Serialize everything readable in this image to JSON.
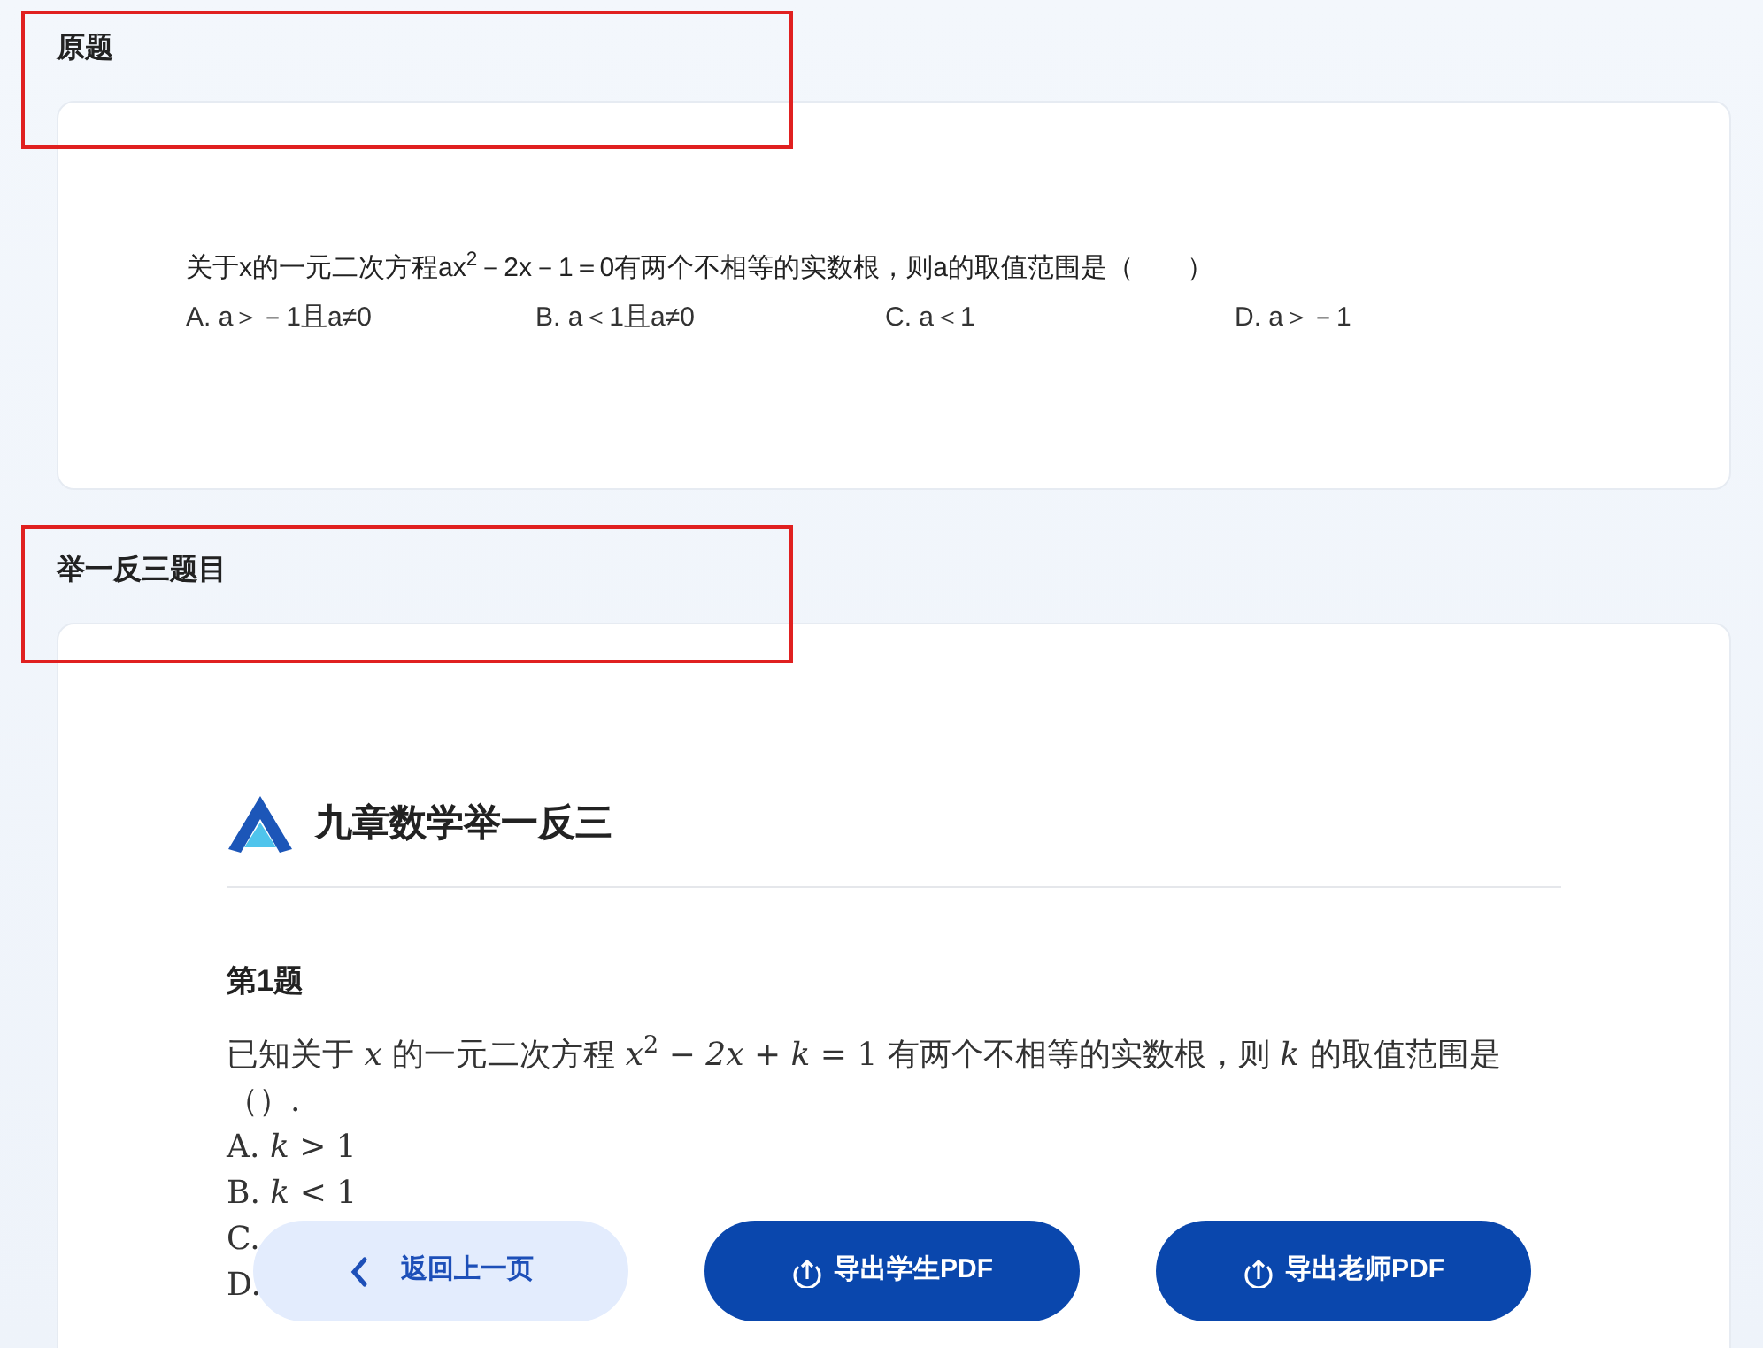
{
  "original": {
    "title": "原题",
    "question": "关于x的一元二次方程ax$^{2}$－2x－1＝0有两个不相等的实数根，则a的取值范围是（　　）",
    "options": [
      "A. a＞－1且a≠0",
      "B. a＜1且a≠0",
      "C. a＜1",
      "D. a＞－1"
    ]
  },
  "variants": {
    "title": "举一反三题目",
    "brand": "九章数学举一反三",
    "problem_title": "第1题",
    "question": "已知关于 *x* 的一元二次方程 *x*$^{2}$ − *2x* + *k* = 1 有两个不相等的实数根，则 *k* 的取值范围是（）.",
    "options": [
      "A. *k* > 1",
      "B. *k* < 1",
      "C.",
      "D."
    ]
  },
  "actions": [
    {
      "label": "返回上一页",
      "kind": "back"
    },
    {
      "label": "导出学生PDF",
      "kind": "export"
    },
    {
      "label": "导出老师PDF",
      "kind": "export"
    }
  ]
}
